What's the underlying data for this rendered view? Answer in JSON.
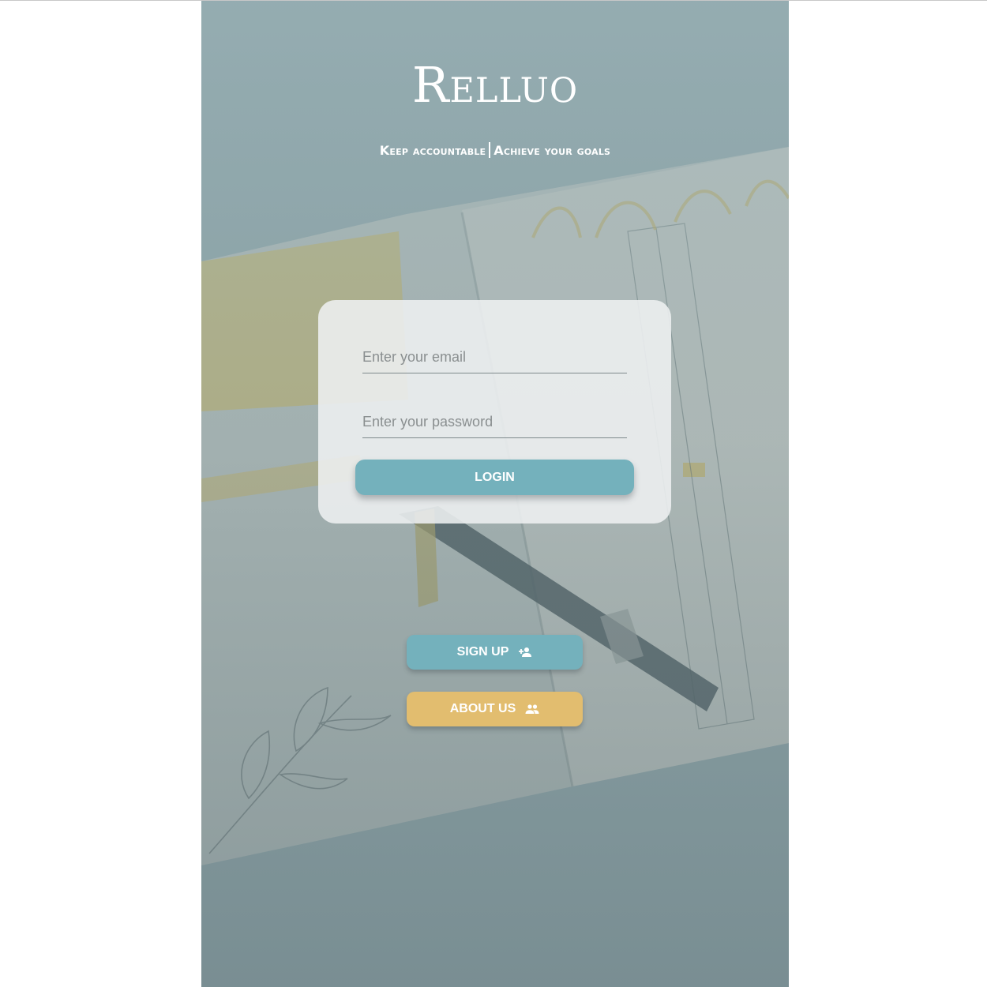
{
  "brand": {
    "title": "Relluo",
    "tagline_left": "Keep accountable",
    "tagline_right": "Achieve your goals"
  },
  "login_form": {
    "email_placeholder": "Enter your email",
    "password_placeholder": "Enter your password",
    "login_label": "LOGIN"
  },
  "actions": {
    "signup_label": "SIGN UP",
    "signup_icon": "person-add-icon",
    "about_label": "ABOUT US",
    "about_icon": "people-icon"
  },
  "colors": {
    "primary_button": "#74b1bc",
    "secondary_button": "#e2bd6f",
    "card_background": "#eef0f1"
  }
}
